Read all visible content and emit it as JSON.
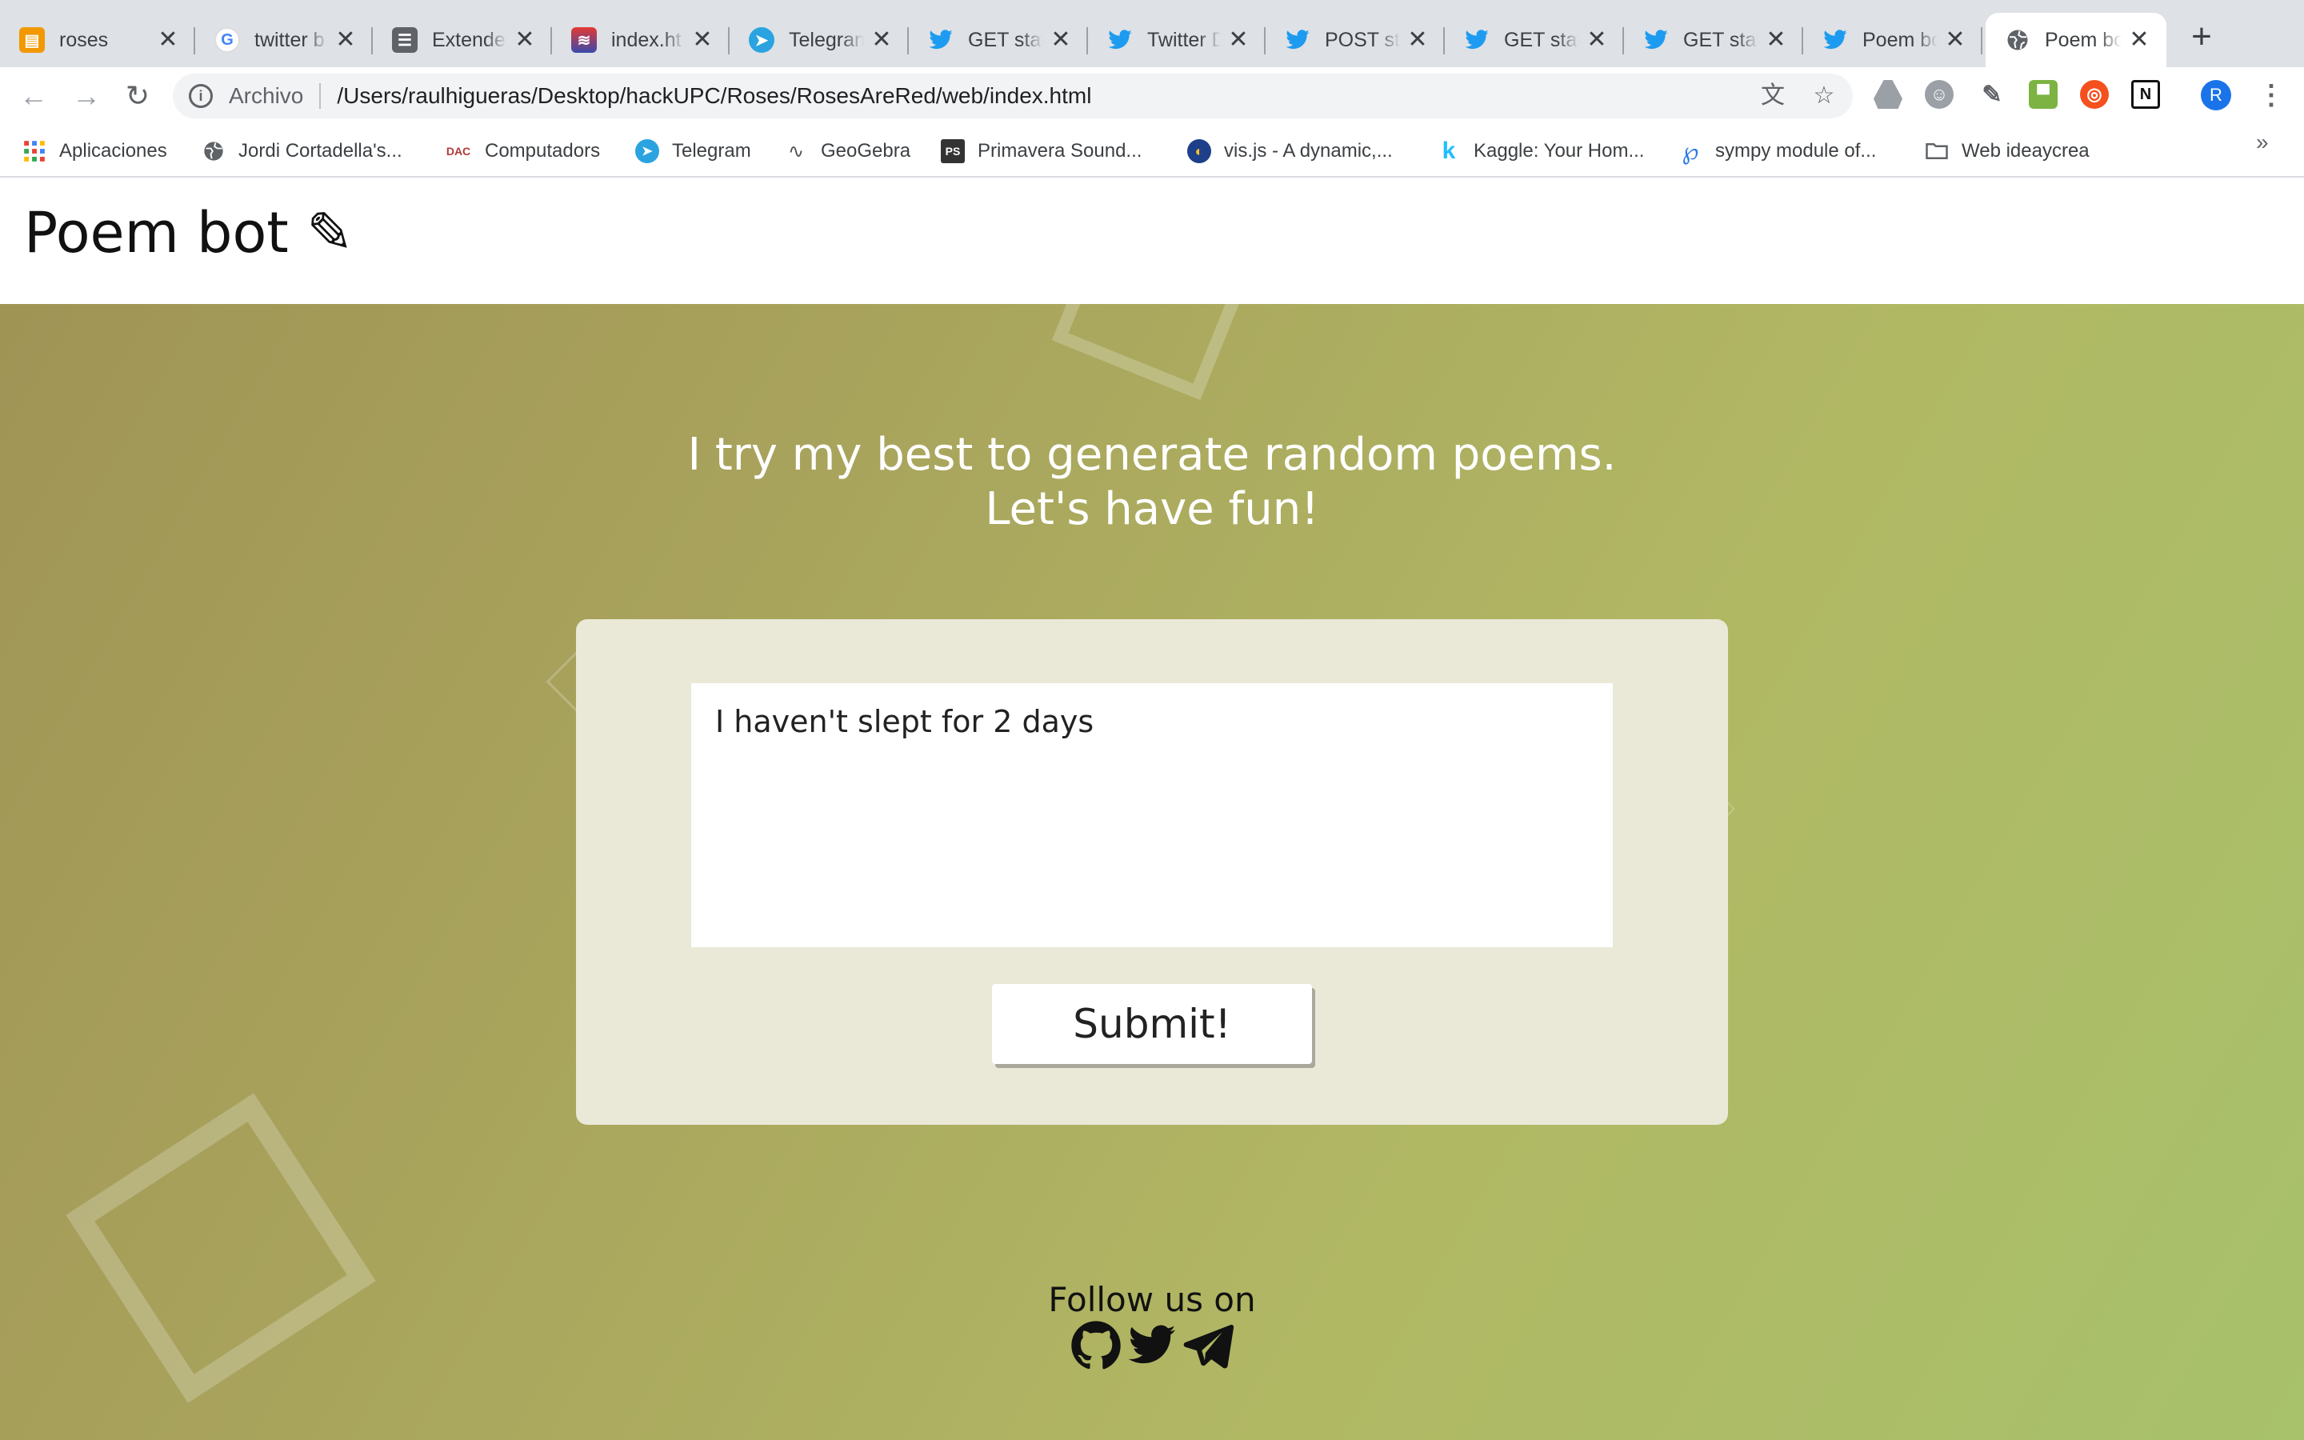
{
  "browser": {
    "tabs": [
      {
        "title": "roses",
        "icon": "book-icon"
      },
      {
        "title": "twitter b",
        "icon": "google-icon"
      },
      {
        "title": "Extende",
        "icon": "docs-icon"
      },
      {
        "title": "index.ht",
        "icon": "stack-icon"
      },
      {
        "title": "Telegran",
        "icon": "telegram-icon"
      },
      {
        "title": "GET stat",
        "icon": "twitter-icon"
      },
      {
        "title": "Twitter D",
        "icon": "twitter-icon"
      },
      {
        "title": "POST st",
        "icon": "twitter-icon"
      },
      {
        "title": "GET stat",
        "icon": "twitter-icon"
      },
      {
        "title": "GET stat",
        "icon": "twitter-icon"
      },
      {
        "title": "Poem bo",
        "icon": "twitter-icon"
      },
      {
        "title": "Poem bo",
        "icon": "globe-icon",
        "active": true
      }
    ],
    "close_glyph": "✕",
    "new_tab_glyph": "+",
    "omnibox": {
      "scheme": "Archivo",
      "url": "/Users/raulhigueras/Desktop/hackUPC/Roses/RosesAreRed/web/index.html"
    },
    "profile_initial": "R",
    "bookmarks": [
      {
        "label": "Aplicaciones",
        "icon": "apps-grid-icon"
      },
      {
        "label": "Jordi Cortadella's...",
        "icon": "globe-icon"
      },
      {
        "label": "Computadors",
        "icon": "dac-icon",
        "icon_text": "DAC"
      },
      {
        "label": "Telegram",
        "icon": "telegram-icon"
      },
      {
        "label": "GeoGebra",
        "icon": "geogebra-icon"
      },
      {
        "label": "Primavera Sound...",
        "icon": "primavera-icon",
        "icon_text": "PS"
      },
      {
        "label": "vis.js - A dynamic,...",
        "icon": "visjs-icon"
      },
      {
        "label": "Kaggle: Your Hom...",
        "icon": "kaggle-icon",
        "icon_text": "k"
      },
      {
        "label": "sympy module of...",
        "icon": "sympy-icon"
      },
      {
        "label": "Web ideaycrea",
        "icon": "folder-icon"
      }
    ],
    "bookmarks_overflow": "»"
  },
  "page": {
    "brand": "Poem bot ✎",
    "tagline_line1": "I try my best to generate random poems.",
    "tagline_line2": "Let's have fun!",
    "input_value": "I haven't slept for 2 days",
    "submit_label": "Submit!",
    "follow_label": "Follow us on",
    "social_links": [
      "github-icon",
      "twitter-icon",
      "telegram-icon"
    ]
  },
  "colors": {
    "twitter_blue": "#1d9bf0",
    "telegram_blue": "#2aa3e0",
    "hero_start": "#a09455",
    "hero_end": "#a8c16b"
  }
}
